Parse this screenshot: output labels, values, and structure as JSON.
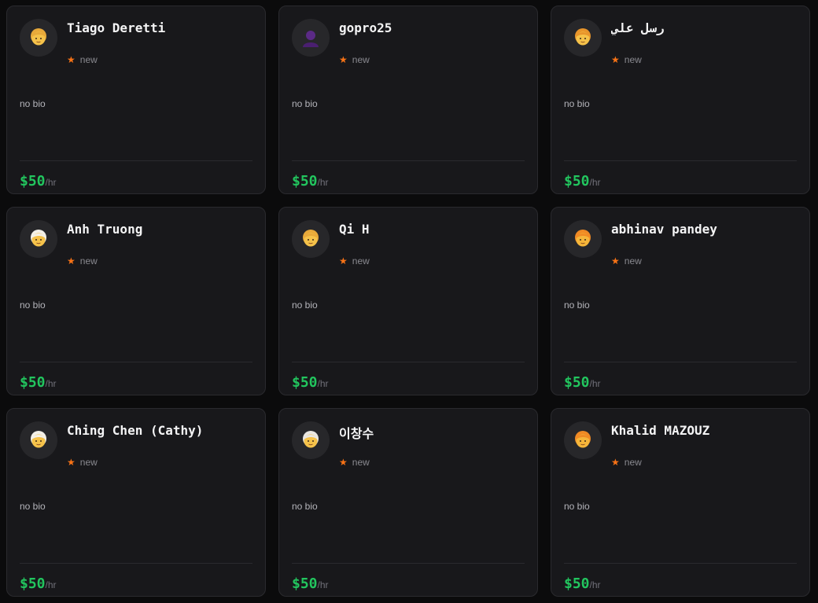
{
  "colors": {
    "background": "#0b0b0c",
    "card": "#18181b",
    "border": "#2a2a2e",
    "accent_star": "#f97316",
    "price": "#22c55e"
  },
  "cards": [
    {
      "name": "Tiago Deretti",
      "rating_label": "new",
      "bio": "no bio",
      "rate": "$50",
      "rate_unit": "/hr",
      "avatar": {
        "icon": "person-blond-icon",
        "skin": "#f5c24a",
        "hair": "#e8a93a"
      }
    },
    {
      "name": "gopro25",
      "rating_label": "new",
      "bio": "no bio",
      "rate": "$50",
      "rate_unit": "/hr",
      "avatar": {
        "icon": "person-silhouette-icon",
        "skin": "#5b2a86",
        "hair": "#4a1f70"
      }
    },
    {
      "name": "رسل علي",
      "rating_label": "new",
      "bio": "no bio",
      "rate": "$50",
      "rate_unit": "/hr",
      "avatar": {
        "icon": "person-curly-hair-icon",
        "skin": "#f5c24a",
        "hair": "#e8952b"
      }
    },
    {
      "name": "Anh Truong",
      "rating_label": "new",
      "bio": "no bio",
      "rate": "$50",
      "rate_unit": "/hr",
      "avatar": {
        "icon": "person-white-hair-icon",
        "skin": "#f5c24a",
        "hair": "#f3f0e8"
      }
    },
    {
      "name": "Qi H",
      "rating_label": "new",
      "bio": "no bio",
      "rate": "$50",
      "rate_unit": "/hr",
      "avatar": {
        "icon": "person-blond-icon",
        "skin": "#f5c24a",
        "hair": "#e8a93a"
      }
    },
    {
      "name": "abhinav pandey",
      "rating_label": "new",
      "bio": "no bio",
      "rate": "$50",
      "rate_unit": "/hr",
      "avatar": {
        "icon": "person-orange-hair-icon",
        "skin": "#f5b53a",
        "hair": "#f08a24"
      }
    },
    {
      "name": "Ching Chen (Cathy)",
      "rating_label": "new",
      "bio": "no bio",
      "rate": "$50",
      "rate_unit": "/hr",
      "avatar": {
        "icon": "person-white-hair-icon",
        "skin": "#f5c24a",
        "hair": "#f3f0e8"
      }
    },
    {
      "name": "이창수",
      "rating_label": "new",
      "bio": "no bio",
      "rate": "$50",
      "rate_unit": "/hr",
      "avatar": {
        "icon": "person-white-hair-icon",
        "skin": "#f5c24a",
        "hair": "#e9e6e1"
      }
    },
    {
      "name": "Khalid MAZOUZ",
      "rating_label": "new",
      "bio": "no bio",
      "rate": "$50",
      "rate_unit": "/hr",
      "avatar": {
        "icon": "person-orange-hair-icon",
        "skin": "#f5b53a",
        "hair": "#f08a24"
      }
    }
  ]
}
